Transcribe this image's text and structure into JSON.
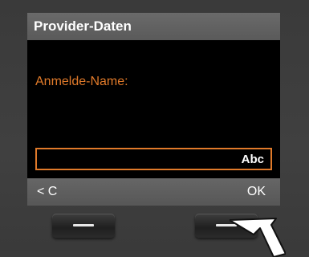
{
  "screen": {
    "title": "Provider-Daten",
    "field_label": "Anmelde-Name:",
    "input_value": "",
    "input_mode": "Abc"
  },
  "softkeys": {
    "left": "< C",
    "right": "OK"
  },
  "colors": {
    "accent": "#e07a2a",
    "screen_bg": "#000000",
    "bar_bg": "#5e5e5e"
  },
  "icons": {
    "left_key": "dash-icon",
    "right_key": "dash-icon",
    "pointer": "arrow-pointer-icon"
  }
}
